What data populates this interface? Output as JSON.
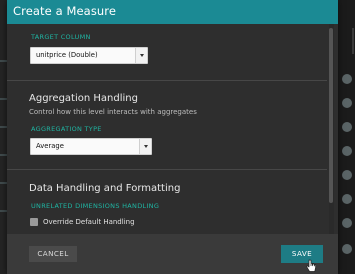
{
  "modal": {
    "title": "Create a Measure"
  },
  "target_column": {
    "label": "TARGET COLUMN",
    "value": "unitprice (Double)"
  },
  "aggregation": {
    "title": "Aggregation Handling",
    "description": "Control how this level interacts with aggregates",
    "type_label": "AGGREGATION TYPE",
    "type_value": "Average"
  },
  "data_handling": {
    "title": "Data Handling and Formatting",
    "unrelated_label": "UNRELATED DIMENSIONS HANDLING",
    "override_label": "Override Default Handling",
    "override_checked": false
  },
  "footer": {
    "cancel_label": "CANCEL",
    "save_label": "SAVE"
  },
  "colors": {
    "header": "#1b8a94",
    "accent_label": "#1fb5a3",
    "save_button": "#1e7c85"
  }
}
